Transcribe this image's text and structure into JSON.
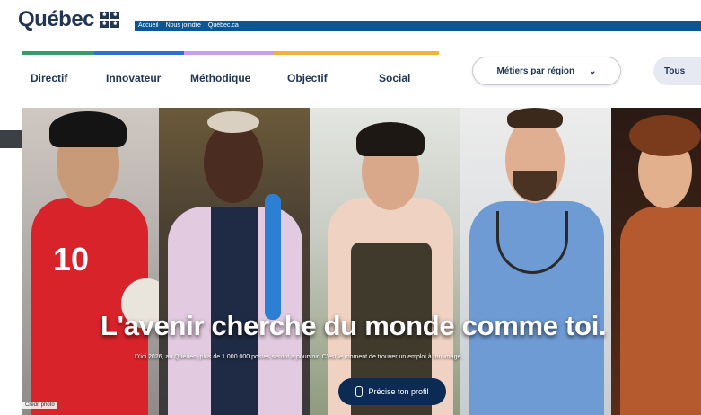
{
  "header": {
    "logo_text": "Québec",
    "links": [
      "Accueil",
      "Nous joindre",
      "Québec.ca"
    ]
  },
  "color_strip": [
    "#3a9a6b",
    "#2f6fd0",
    "#c6a0e8",
    "#f0b33a"
  ],
  "nav": {
    "items": [
      "Directif",
      "Innovateur",
      "Méthodique",
      "Objectif",
      "Social"
    ]
  },
  "filters": {
    "select_label": "Métiers par région",
    "tous_label": "Tous"
  },
  "hero": {
    "title": "L'avenir cherche du monde comme toi.",
    "subtitle": "D'ici 2026, au Québec, plus de 1 000 000 postes seront à pourvoir. C'est le moment de trouver un emploi à ton image.",
    "cta_label": "Précise ton profil",
    "jersey_number": "10",
    "photo_credit": "Crédit photo"
  },
  "icons": {
    "select_chevron": "chevron-down-icon",
    "cta_icon": "phone-icon",
    "logo_flag": "fleur-de-lys-flag-icon"
  }
}
